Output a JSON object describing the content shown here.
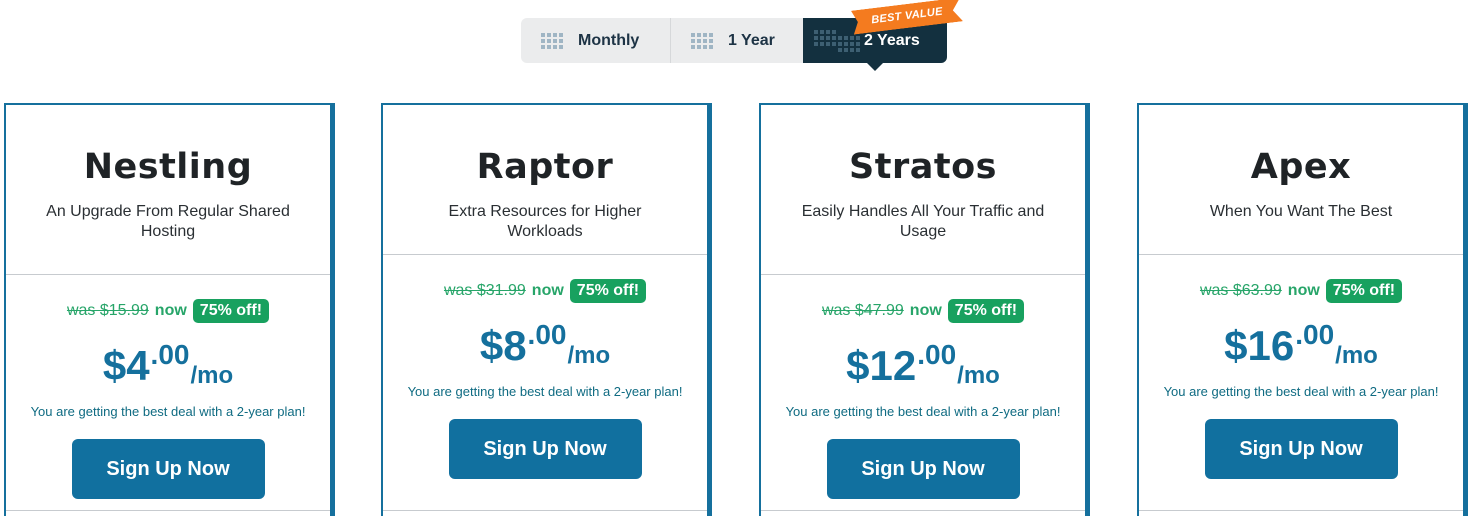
{
  "billing_toggle": {
    "options": [
      {
        "label": "Monthly",
        "icon": "grid-icon",
        "selected": false
      },
      {
        "label": "1 Year",
        "icon": "grid-icon",
        "selected": false
      },
      {
        "label": "2 Years",
        "icon": "grid-stack-icon",
        "selected": true
      }
    ],
    "ribbon": "BEST VALUE",
    "colors": {
      "selected_bg": "#13303f",
      "ribbon": "#f47b1f"
    }
  },
  "plans": [
    {
      "name": "Nestling",
      "tagline": "An Upgrade From Regular Shared Hosting",
      "was": "was $15.99",
      "now": "now",
      "badge": "75% off!",
      "currency": "$",
      "amount": "4",
      "cents": ".00",
      "period": "/mo",
      "deal_note": "You are getting the best deal with a 2-year plan!",
      "cta": "Sign Up Now"
    },
    {
      "name": "Raptor",
      "tagline": "Extra Resources for Higher Workloads",
      "was": "was $31.99",
      "now": "now",
      "badge": "75% off!",
      "currency": "$",
      "amount": "8",
      "cents": ".00",
      "period": "/mo",
      "deal_note": "You are getting the best deal with a 2-year plan!",
      "cta": "Sign Up Now"
    },
    {
      "name": "Stratos",
      "tagline": "Easily Handles All Your Traffic and Usage",
      "was": "was $47.99",
      "now": "now",
      "badge": "75% off!",
      "currency": "$",
      "amount": "12",
      "cents": ".00",
      "period": "/mo",
      "deal_note": "You are getting the best deal with a 2-year plan!",
      "cta": "Sign Up Now"
    },
    {
      "name": "Apex",
      "tagline": "When You Want The Best",
      "was": "was $63.99",
      "now": "now",
      "badge": "75% off!",
      "currency": "$",
      "amount": "16",
      "cents": ".00",
      "period": "/mo",
      "deal_note": "You are getting the best deal with a 2-year plan!",
      "cta": "Sign Up Now"
    }
  ],
  "colors": {
    "brand_blue": "#15709d",
    "discount_green": "#18a15f",
    "cta_blue": "#11709f"
  }
}
